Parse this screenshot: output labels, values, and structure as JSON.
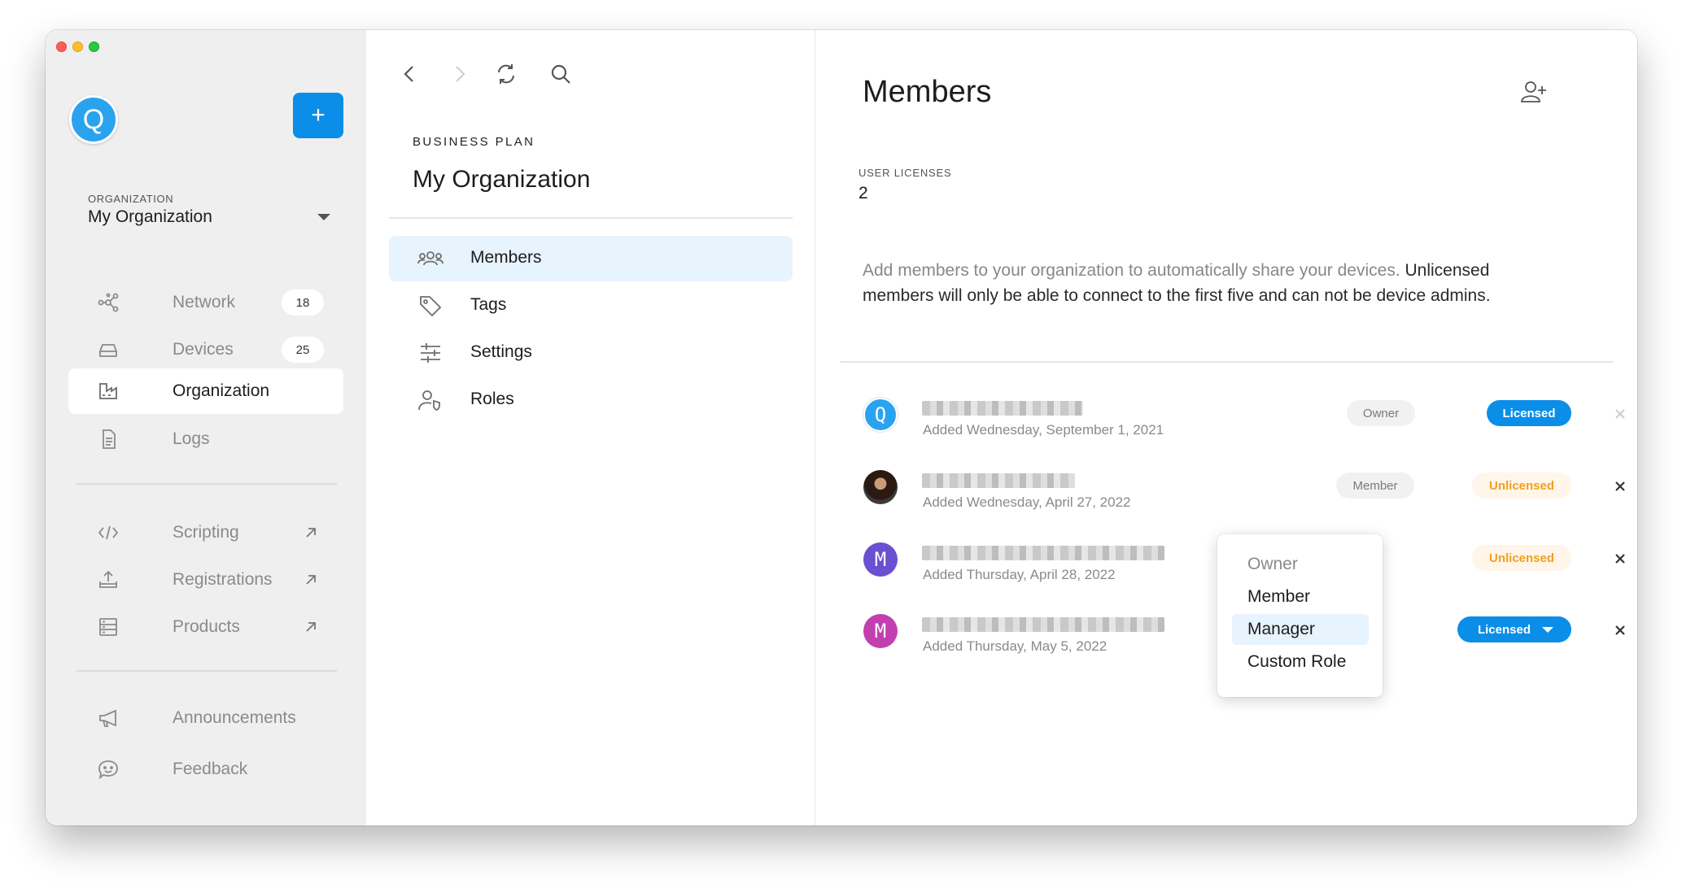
{
  "sidebar": {
    "avatar_letter": "Q",
    "add_label": "+",
    "organization_label": "ORGANIZATION",
    "organization_name": "My Organization",
    "items": [
      {
        "label": "Network",
        "icon": "network-icon",
        "badge": "18"
      },
      {
        "label": "Devices",
        "icon": "devices-icon",
        "badge": "25"
      },
      {
        "label": "Organization",
        "icon": "organization-icon",
        "active": true
      },
      {
        "label": "Logs",
        "icon": "logs-icon"
      }
    ],
    "external_items": [
      {
        "label": "Scripting",
        "icon": "code-icon"
      },
      {
        "label": "Registrations",
        "icon": "upload-icon"
      },
      {
        "label": "Products",
        "icon": "products-icon"
      }
    ],
    "footer_items": [
      {
        "label": "Announcements",
        "icon": "megaphone-icon"
      },
      {
        "label": "Feedback",
        "icon": "feedback-icon"
      }
    ]
  },
  "middle": {
    "plan_label": "BUSINESS PLAN",
    "org_name": "My Organization",
    "items": [
      {
        "label": "Members",
        "icon": "members-icon",
        "active": true
      },
      {
        "label": "Tags",
        "icon": "tag-icon"
      },
      {
        "label": "Settings",
        "icon": "sliders-icon"
      },
      {
        "label": "Roles",
        "icon": "roles-icon"
      }
    ]
  },
  "content": {
    "title": "Members",
    "user_licenses_label": "USER LICENSES",
    "user_licenses_value": "2",
    "description_muted": "Add members to your organization to automatically share your devices. ",
    "description_strong": "Unlicensed members will only be able to connect to the first five and can not be device admins.",
    "members": [
      {
        "avatar": "Q",
        "avatar_color": "#2aa3ef",
        "added": "Added Wednesday, September 1, 2021",
        "role": "Owner",
        "license": "Licensed"
      },
      {
        "avatar": "",
        "avatar_color": "#3a3a3a",
        "added": "Added Wednesday, April 27, 2022",
        "role": "Member",
        "license": "Unlicensed"
      },
      {
        "avatar": "M",
        "avatar_color": "#6a4fd1",
        "added": "Added Thursday, April 28, 2022",
        "role": "",
        "license": "Unlicensed"
      },
      {
        "avatar": "M",
        "avatar_color": "#c23fb0",
        "added": "Added Thursday, May 5, 2022",
        "role": "",
        "license": "Licensed"
      }
    ]
  },
  "role_dropdown": {
    "options": [
      "Owner",
      "Member",
      "Manager",
      "Custom Role"
    ],
    "selected": "Manager"
  },
  "colors": {
    "accent": "#0a8ee8",
    "unlicensed": "#f0a020",
    "sidebar_bg": "#efefef",
    "selection_bg": "#e7f3fd"
  }
}
